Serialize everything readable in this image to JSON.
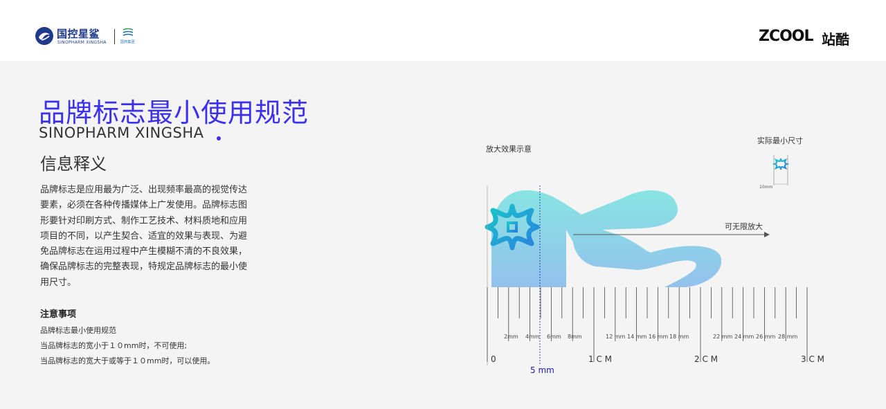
{
  "header": {
    "brand_cn": "国控星鲨",
    "brand_en": "SINOPHARM XINGSHA",
    "group_cn": "国药集团",
    "zcool_logo": "ZCOOL",
    "zcool_cn": "站酷"
  },
  "main": {
    "title_cn": "品牌标志最小使用规范",
    "title_en": "SINOPHARM XINGSHA",
    "section_title": "信息释义",
    "paragraph_lines": [
      "品牌标志是应用最为广泛、出现频率最高的视觉传达",
      "要素，必须在各种传播媒体上广发使用。品牌标志图",
      "形要针对印刷方式、制作工艺技术、材料质地和应用",
      "项目的不同，以产生契合、适宜的效果与表现、为避",
      "免品牌标志在运用过程中产生模糊不清的不良效果，",
      "确保品牌标志的完整表现，特规定品牌标志的最小使",
      "用尺寸。"
    ],
    "notes_title": "注意事项",
    "notes": [
      "品牌标志最小使用规范",
      "当品牌标志的宽小于１０mm时，不可使用;",
      "当品牌标志的宽大于或等于１０mm时，可以使用。"
    ]
  },
  "diagram": {
    "magnify_label": "放大效果示意",
    "actual_label": "实际最小尺寸",
    "actual_dim": "10mm",
    "unlimited_label": "可无限放大",
    "mm_labels": [
      "2mm",
      "4mm",
      "6mm",
      "8mm",
      "12 mm",
      "14 mm",
      "16 mm",
      "18 mm",
      "22 mm",
      "24 mm",
      "26 mm",
      "28 mm"
    ],
    "zero_label": "0",
    "cm_labels": [
      "1 C M",
      "2 C M",
      "3 C M"
    ],
    "five_mm_label": "5 mm",
    "colors": {
      "accent": "#3b2ff0",
      "logo_teal": "#19c8c8",
      "logo_blue": "#2a80e0",
      "marker": "#1a1aa8"
    }
  },
  "icons": [
    "sinopharm-xingsha-logo-icon",
    "sinopharm-group-logo-icon",
    "brand-symbol-icon",
    "arrow-right-icon"
  ]
}
